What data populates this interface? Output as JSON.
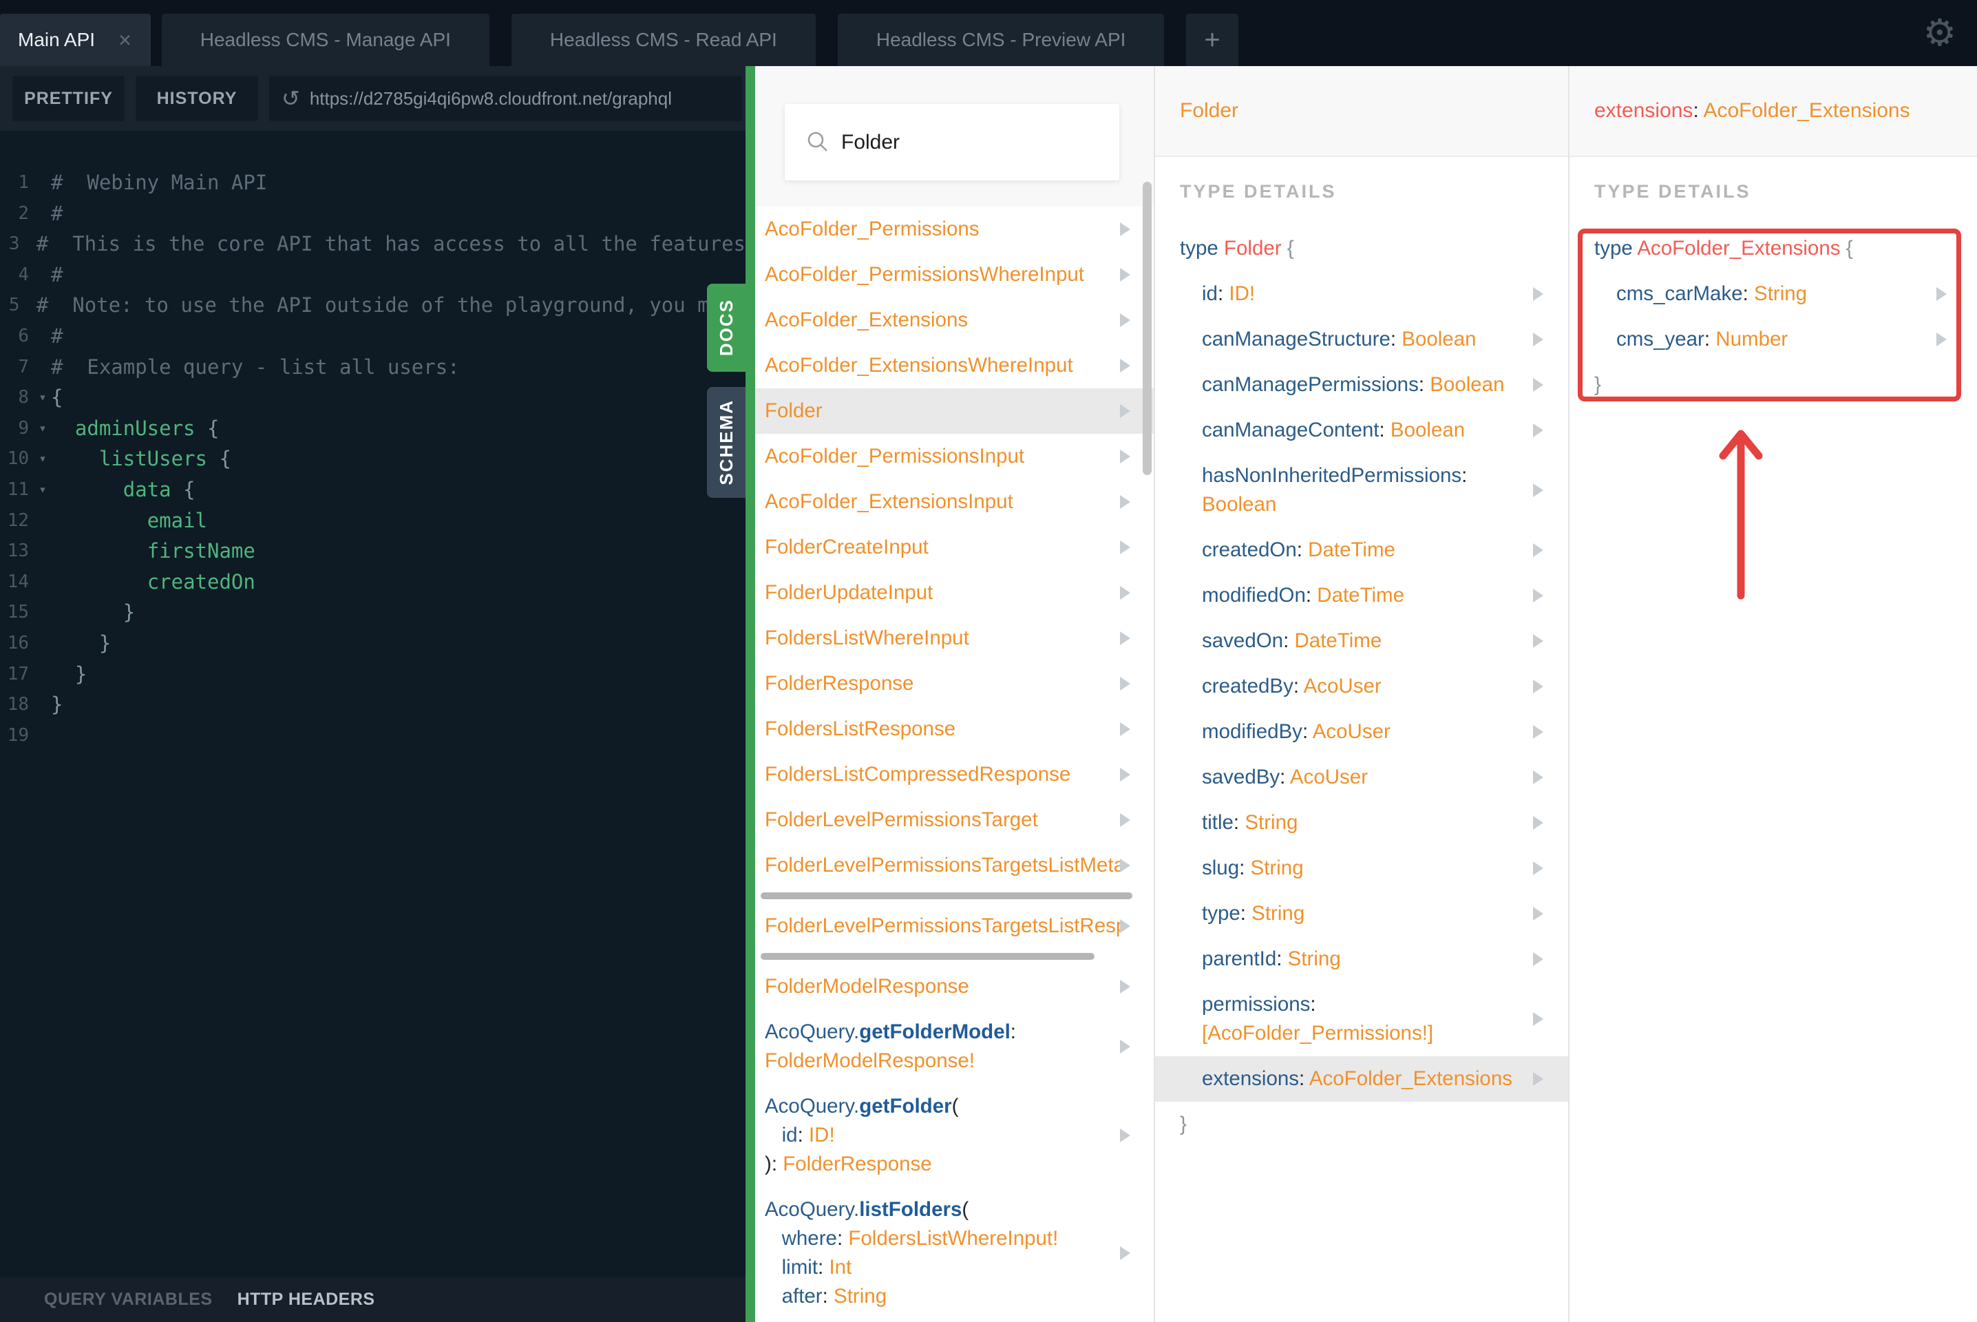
{
  "tab_bar": {
    "tabs": [
      {
        "label": "Main API",
        "active": true,
        "closable": true
      },
      {
        "label": "Headless CMS - Manage API",
        "active": false
      },
      {
        "label": "Headless CMS - Read API",
        "active": false
      },
      {
        "label": "Headless CMS - Preview API",
        "active": false
      }
    ],
    "add_tab_label": "+",
    "close_icon": "×",
    "gear_icon": "⚙"
  },
  "toolbar": {
    "prettify_label": "PRETTIFY",
    "history_label": "HISTORY",
    "url": "https://d2785gi4qi6pw8.cloudfront.net/graphql",
    "reload_icon": "↺"
  },
  "editor": {
    "docs_tab_label": "DOCS",
    "schema_tab_label": "SCHEMA",
    "lines": [
      {
        "n": 1,
        "segs": [
          {
            "t": "#  Webiny Main API",
            "c": "comment"
          }
        ]
      },
      {
        "n": 2,
        "segs": [
          {
            "t": "#",
            "c": "comment"
          }
        ]
      },
      {
        "n": 3,
        "segs": [
          {
            "t": "#  This is the core API that has access to all the features",
            "c": "comment"
          }
        ]
      },
      {
        "n": 4,
        "segs": [
          {
            "t": "#",
            "c": "comment"
          }
        ]
      },
      {
        "n": 5,
        "segs": [
          {
            "t": "#  Note: to use the API outside of the playground, you must",
            "c": "comment"
          }
        ]
      },
      {
        "n": 6,
        "segs": [
          {
            "t": "#",
            "c": "comment"
          }
        ]
      },
      {
        "n": 7,
        "segs": [
          {
            "t": "#  Example query - list all users:",
            "c": "comment"
          }
        ]
      },
      {
        "n": 8,
        "fold": true,
        "segs": [
          {
            "t": "{",
            "c": "punc"
          }
        ]
      },
      {
        "n": 9,
        "fold": true,
        "segs": [
          {
            "t": "  ",
            "c": "punc"
          },
          {
            "t": "adminUsers",
            "c": "field"
          },
          {
            "t": " {",
            "c": "punc"
          }
        ]
      },
      {
        "n": 10,
        "fold": true,
        "segs": [
          {
            "t": "    ",
            "c": "punc"
          },
          {
            "t": "listUsers",
            "c": "field"
          },
          {
            "t": " {",
            "c": "punc"
          }
        ]
      },
      {
        "n": 11,
        "fold": true,
        "segs": [
          {
            "t": "      ",
            "c": "punc"
          },
          {
            "t": "data",
            "c": "field"
          },
          {
            "t": " {",
            "c": "punc"
          }
        ]
      },
      {
        "n": 12,
        "segs": [
          {
            "t": "        ",
            "c": "punc"
          },
          {
            "t": "email",
            "c": "field"
          }
        ]
      },
      {
        "n": 13,
        "segs": [
          {
            "t": "        ",
            "c": "punc"
          },
          {
            "t": "firstName",
            "c": "field"
          }
        ]
      },
      {
        "n": 14,
        "segs": [
          {
            "t": "        ",
            "c": "punc"
          },
          {
            "t": "createdOn",
            "c": "field"
          }
        ]
      },
      {
        "n": 15,
        "segs": [
          {
            "t": "      }",
            "c": "punc"
          }
        ]
      },
      {
        "n": 16,
        "segs": [
          {
            "t": "    }",
            "c": "punc"
          }
        ]
      },
      {
        "n": 17,
        "segs": [
          {
            "t": "  }",
            "c": "punc"
          }
        ]
      },
      {
        "n": 18,
        "segs": [
          {
            "t": "}",
            "c": "punc"
          }
        ]
      },
      {
        "n": 19,
        "segs": []
      }
    ]
  },
  "footer": {
    "query_variables_label": "QUERY VARIABLES",
    "http_headers_label": "HTTP HEADERS"
  },
  "docs_panel": {
    "search_value": "Folder",
    "items": [
      {
        "lines": [
          [
            {
              "t": "AcoFolder_Permissions",
              "c": "o"
            }
          ]
        ]
      },
      {
        "lines": [
          [
            {
              "t": "AcoFolder_PermissionsWhereInput",
              "c": "o"
            }
          ]
        ]
      },
      {
        "lines": [
          [
            {
              "t": "AcoFolder_Extensions",
              "c": "o"
            }
          ]
        ]
      },
      {
        "lines": [
          [
            {
              "t": "AcoFolder_ExtensionsWhereInput",
              "c": "o"
            }
          ]
        ]
      },
      {
        "selected": true,
        "lines": [
          [
            {
              "t": "Folder",
              "c": "o"
            }
          ]
        ]
      },
      {
        "lines": [
          [
            {
              "t": "AcoFolder_PermissionsInput",
              "c": "o"
            }
          ]
        ]
      },
      {
        "lines": [
          [
            {
              "t": "AcoFolder_ExtensionsInput",
              "c": "o"
            }
          ]
        ]
      },
      {
        "lines": [
          [
            {
              "t": "FolderCreateInput",
              "c": "o"
            }
          ]
        ]
      },
      {
        "lines": [
          [
            {
              "t": "FolderUpdateInput",
              "c": "o"
            }
          ]
        ]
      },
      {
        "lines": [
          [
            {
              "t": "FoldersListWhereInput",
              "c": "o"
            }
          ]
        ]
      },
      {
        "lines": [
          [
            {
              "t": "FolderResponse",
              "c": "o"
            }
          ]
        ]
      },
      {
        "lines": [
          [
            {
              "t": "FoldersListResponse",
              "c": "o"
            }
          ]
        ]
      },
      {
        "lines": [
          [
            {
              "t": "FoldersListCompressedResponse",
              "c": "o"
            }
          ]
        ]
      },
      {
        "lines": [
          [
            {
              "t": "FolderLevelPermissionsTarget",
              "c": "o"
            }
          ]
        ]
      },
      {
        "hscroll": 540,
        "lines": [
          [
            {
              "t": "FolderLevelPermissionsTargetsListMeta",
              "c": "o"
            }
          ]
        ]
      },
      {
        "hscroll": 485,
        "lines": [
          [
            {
              "t": "FolderLevelPermissionsTargetsListRespo",
              "c": "o"
            }
          ]
        ]
      },
      {
        "lines": [
          [
            {
              "t": "FolderModelResponse",
              "c": "o"
            }
          ]
        ]
      },
      {
        "lines": [
          [
            {
              "t": "AcoQuery.",
              "c": "b"
            },
            {
              "t": "getFolderModel",
              "c": "bb"
            },
            {
              "t": ":",
              "c": "d"
            }
          ],
          [
            {
              "t": "FolderModelResponse!",
              "c": "o"
            }
          ]
        ]
      },
      {
        "lines": [
          [
            {
              "t": "AcoQuery.",
              "c": "b"
            },
            {
              "t": "getFolder",
              "c": "bb"
            },
            {
              "t": "(",
              "c": "d"
            }
          ],
          [
            {
              "t": "   ",
              "c": "d"
            },
            {
              "t": "id",
              "c": "b"
            },
            {
              "t": ": ",
              "c": "d"
            },
            {
              "t": "ID!",
              "c": "o"
            }
          ],
          [
            {
              "t": "): ",
              "c": "d"
            },
            {
              "t": "FolderResponse",
              "c": "o"
            }
          ]
        ]
      },
      {
        "lines": [
          [
            {
              "t": "AcoQuery.",
              "c": "b"
            },
            {
              "t": "listFolders",
              "c": "bb"
            },
            {
              "t": "(",
              "c": "d"
            }
          ],
          [
            {
              "t": "   ",
              "c": "d"
            },
            {
              "t": "where",
              "c": "b"
            },
            {
              "t": ": ",
              "c": "d"
            },
            {
              "t": "FoldersListWhereInput!",
              "c": "o"
            }
          ],
          [
            {
              "t": "   ",
              "c": "d"
            },
            {
              "t": "limit",
              "c": "b"
            },
            {
              "t": ": ",
              "c": "d"
            },
            {
              "t": "Int",
              "c": "o"
            }
          ],
          [
            {
              "t": "   ",
              "c": "d"
            },
            {
              "t": "after",
              "c": "b"
            },
            {
              "t": ": ",
              "c": "d"
            },
            {
              "t": "String",
              "c": "o"
            }
          ]
        ]
      }
    ]
  },
  "type_panel": {
    "header": [
      {
        "t": "Folder",
        "c": "o"
      }
    ],
    "section_label": "TYPE DETAILS",
    "rows": [
      {
        "arrow": false,
        "lines": [
          [
            {
              "t": "type ",
              "c": "b"
            },
            {
              "t": "Folder",
              "c": "r"
            },
            {
              "t": " {",
              "c": "g"
            }
          ]
        ]
      },
      {
        "indent": true,
        "lines": [
          [
            {
              "t": "id",
              "c": "b"
            },
            {
              "t": ": ",
              "c": "d"
            },
            {
              "t": "ID!",
              "c": "o"
            }
          ]
        ]
      },
      {
        "indent": true,
        "lines": [
          [
            {
              "t": "canManageStructure",
              "c": "b"
            },
            {
              "t": ": ",
              "c": "d"
            },
            {
              "t": "Boolean",
              "c": "o"
            }
          ]
        ]
      },
      {
        "indent": true,
        "lines": [
          [
            {
              "t": "canManagePermissions",
              "c": "b"
            },
            {
              "t": ": ",
              "c": "d"
            },
            {
              "t": "Boolean",
              "c": "o"
            }
          ]
        ]
      },
      {
        "indent": true,
        "lines": [
          [
            {
              "t": "canManageContent",
              "c": "b"
            },
            {
              "t": ": ",
              "c": "d"
            },
            {
              "t": "Boolean",
              "c": "o"
            }
          ]
        ]
      },
      {
        "indent": true,
        "lines": [
          [
            {
              "t": "hasNonInheritedPermissions",
              "c": "b"
            },
            {
              "t": ":",
              "c": "d"
            }
          ],
          [
            {
              "t": "Boolean",
              "c": "o"
            }
          ]
        ]
      },
      {
        "indent": true,
        "lines": [
          [
            {
              "t": "createdOn",
              "c": "b"
            },
            {
              "t": ": ",
              "c": "d"
            },
            {
              "t": "DateTime",
              "c": "o"
            }
          ]
        ]
      },
      {
        "indent": true,
        "lines": [
          [
            {
              "t": "modifiedOn",
              "c": "b"
            },
            {
              "t": ": ",
              "c": "d"
            },
            {
              "t": "DateTime",
              "c": "o"
            }
          ]
        ]
      },
      {
        "indent": true,
        "lines": [
          [
            {
              "t": "savedOn",
              "c": "b"
            },
            {
              "t": ": ",
              "c": "d"
            },
            {
              "t": "DateTime",
              "c": "o"
            }
          ]
        ]
      },
      {
        "indent": true,
        "lines": [
          [
            {
              "t": "createdBy",
              "c": "b"
            },
            {
              "t": ": ",
              "c": "d"
            },
            {
              "t": "AcoUser",
              "c": "o"
            }
          ]
        ]
      },
      {
        "indent": true,
        "lines": [
          [
            {
              "t": "modifiedBy",
              "c": "b"
            },
            {
              "t": ": ",
              "c": "d"
            },
            {
              "t": "AcoUser",
              "c": "o"
            }
          ]
        ]
      },
      {
        "indent": true,
        "lines": [
          [
            {
              "t": "savedBy",
              "c": "b"
            },
            {
              "t": ": ",
              "c": "d"
            },
            {
              "t": "AcoUser",
              "c": "o"
            }
          ]
        ]
      },
      {
        "indent": true,
        "lines": [
          [
            {
              "t": "title",
              "c": "b"
            },
            {
              "t": ": ",
              "c": "d"
            },
            {
              "t": "String",
              "c": "o"
            }
          ]
        ]
      },
      {
        "indent": true,
        "lines": [
          [
            {
              "t": "slug",
              "c": "b"
            },
            {
              "t": ": ",
              "c": "d"
            },
            {
              "t": "String",
              "c": "o"
            }
          ]
        ]
      },
      {
        "indent": true,
        "lines": [
          [
            {
              "t": "type",
              "c": "b"
            },
            {
              "t": ": ",
              "c": "d"
            },
            {
              "t": "String",
              "c": "o"
            }
          ]
        ]
      },
      {
        "indent": true,
        "lines": [
          [
            {
              "t": "parentId",
              "c": "b"
            },
            {
              "t": ": ",
              "c": "d"
            },
            {
              "t": "String",
              "c": "o"
            }
          ]
        ]
      },
      {
        "indent": true,
        "lines": [
          [
            {
              "t": "permissions",
              "c": "b"
            },
            {
              "t": ":",
              "c": "d"
            }
          ],
          [
            {
              "t": "[AcoFolder_Permissions!]",
              "c": "o"
            }
          ]
        ]
      },
      {
        "indent": true,
        "selected": true,
        "lines": [
          [
            {
              "t": "extensions",
              "c": "b"
            },
            {
              "t": ": ",
              "c": "d"
            },
            {
              "t": "AcoFolder_Extensions",
              "c": "o"
            }
          ]
        ]
      },
      {
        "arrow": false,
        "lines": [
          [
            {
              "t": "}",
              "c": "g"
            }
          ]
        ]
      }
    ]
  },
  "extensions_panel": {
    "header": [
      {
        "t": "extensions",
        "c": "r"
      },
      {
        "t": ": ",
        "c": "d"
      },
      {
        "t": "AcoFolder_Extensions",
        "c": "o"
      }
    ],
    "section_label": "TYPE DETAILS",
    "rows": [
      {
        "arrow": false,
        "lines": [
          [
            {
              "t": "type ",
              "c": "b"
            },
            {
              "t": "AcoFolder_Extensions",
              "c": "r"
            },
            {
              "t": " {",
              "c": "g"
            }
          ]
        ]
      },
      {
        "indent": true,
        "lines": [
          [
            {
              "t": "cms_carMake",
              "c": "b"
            },
            {
              "t": ": ",
              "c": "d"
            },
            {
              "t": "String",
              "c": "o"
            }
          ]
        ]
      },
      {
        "indent": true,
        "lines": [
          [
            {
              "t": "cms_year",
              "c": "b"
            },
            {
              "t": ": ",
              "c": "d"
            },
            {
              "t": "Number",
              "c": "o"
            }
          ]
        ]
      },
      {
        "arrow": false,
        "lines": [
          [
            {
              "t": "}",
              "c": "g"
            }
          ]
        ]
      }
    ]
  },
  "colors": {
    "accent_green": "#3f9f55",
    "docs_orange": "#f0912c",
    "field_blue": "#2b5c89",
    "selected_coral": "#f25c54",
    "annotation_red": "#e5413e",
    "editor_background": "#0e1a24",
    "topbar_background": "#0c131c"
  }
}
